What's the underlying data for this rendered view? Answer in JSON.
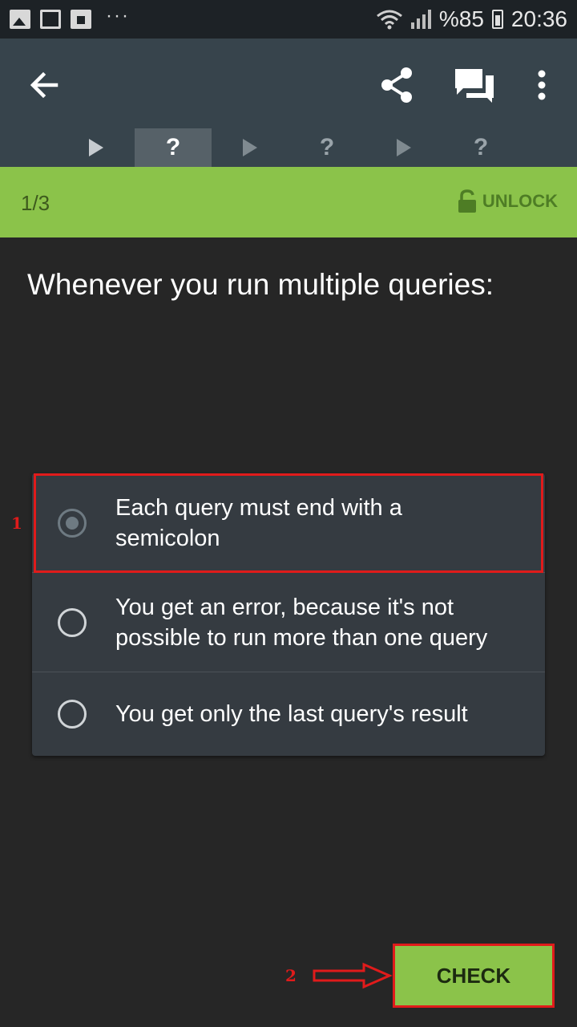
{
  "status_bar": {
    "battery": "%85",
    "time": "20:36",
    "icons": [
      "image-icon",
      "mail-icon",
      "flipboard-icon",
      "more-dots",
      "wifi-icon",
      "signal-icon",
      "battery-icon"
    ]
  },
  "app_bar": {
    "icons": [
      "back-arrow-icon",
      "share-icon",
      "chat-icon",
      "more-vert-icon"
    ]
  },
  "steps": [
    "play",
    "?",
    "play",
    "?",
    "play",
    "?"
  ],
  "progress": {
    "counter": "1/3",
    "unlock_label": "UNLOCK"
  },
  "question": "Whenever you run multiple queries:",
  "options": [
    {
      "text": "Each query must end with a semicolon",
      "selected": true
    },
    {
      "text": "You get an error, because it's not possible to run more than one query",
      "selected": false
    },
    {
      "text": "You get only the last query's result",
      "selected": false
    }
  ],
  "annotations": {
    "one": "1",
    "two": "2"
  },
  "check_button": "CHECK",
  "colors": {
    "accent_green": "#8bc34a",
    "appbar": "#37444c",
    "annotation_red": "#e01b1b"
  }
}
